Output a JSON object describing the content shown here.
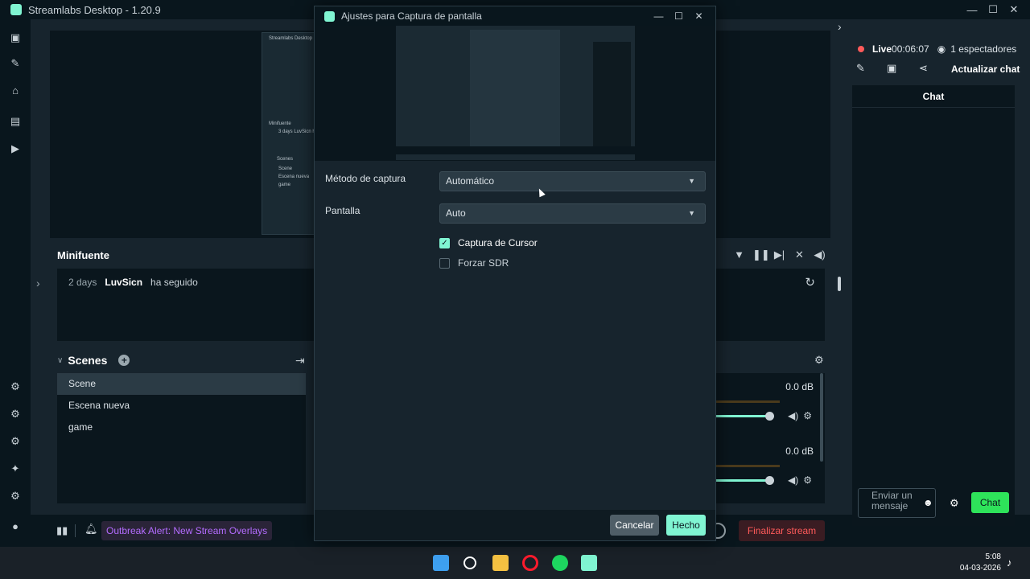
{
  "app": {
    "title": "Streamlabs Desktop - 1.20.9",
    "window_controls": [
      "—",
      "☐",
      "✕"
    ]
  },
  "rail": {
    "icons": [
      "editor-icon",
      "themes-icon",
      "store-icon",
      "highlighter-icon",
      "play-icon",
      "apps-icon",
      "ultra-icon",
      "plugin-icon",
      "ai-icon",
      "settings-icon",
      "profile-icon"
    ]
  },
  "preview_thumb": {
    "texts": [
      "Streamlabs Desktop - 1.20.9",
      "Minifuente",
      "3 days  LuvSicn ha",
      "Scenes",
      "Scene",
      "Escena nueva",
      "game"
    ]
  },
  "minifuente": {
    "title": "Minifuente",
    "event": {
      "time": "2 days",
      "user": "LuvSicn",
      "action": "ha seguido"
    }
  },
  "scenes": {
    "title": "Scenes",
    "items": [
      {
        "label": "Scene",
        "active": true
      },
      {
        "label": "Escena nueva",
        "active": false
      },
      {
        "label": "game",
        "active": false
      }
    ]
  },
  "mixer": {
    "sources": [
      {
        "db": "0.0 dB",
        "volume": 0.95
      },
      {
        "db": "0.0 dB",
        "volume": 0.95
      }
    ]
  },
  "bottombar": {
    "alert": "Outbreak Alert: New Stream Overlays",
    "end_stream": "Finalizar stream"
  },
  "stream": {
    "live_label": "Live",
    "time": "00:06:07",
    "viewers": "1 espectadores",
    "refresh_chat": "Actualizar chat"
  },
  "chat": {
    "title": "Chat",
    "input_placeholder": "Enviar un mensaje",
    "send_label": "Chat"
  },
  "modal": {
    "title": "Ajustes para Captura de pantalla",
    "capture_method_label": "Método de captura",
    "capture_method_value": "Automático",
    "display_label": "Pantalla",
    "display_value": "Auto",
    "checkbox_cursor": {
      "label": "Captura de Cursor",
      "checked": true
    },
    "checkbox_sdr": {
      "label": "Forzar SDR",
      "checked": false
    },
    "cancel_label": "Cancelar",
    "done_label": "Hecho"
  },
  "taskbar": {
    "time": "5:08",
    "date": "04-03-2026",
    "apps": [
      "windows-start-icon",
      "search-icon",
      "file-explorer-icon",
      "opera-icon",
      "spotify-icon",
      "streamlabs-icon"
    ]
  },
  "colors": {
    "accent": "#80f5d2",
    "live": "#ff5a5a",
    "chat_send": "#2ee35a",
    "alert_text": "#b46cff"
  }
}
